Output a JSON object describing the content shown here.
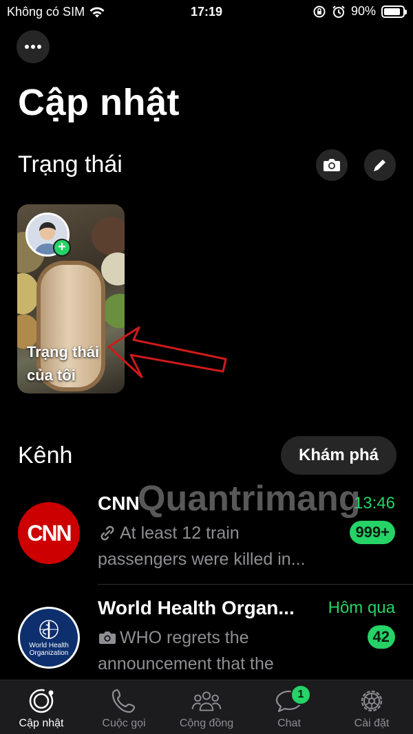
{
  "status_bar": {
    "carrier": "Không có SIM",
    "time": "17:19",
    "battery": "90%",
    "battery_level": 0.9
  },
  "page": {
    "title": "Cập nhật"
  },
  "status_section": {
    "title": "Trạng thái",
    "camera_icon": "camera-icon",
    "pencil_icon": "pencil-icon",
    "my_status_label": "Trạng thái của tôi"
  },
  "channels_section": {
    "title": "Kênh",
    "explore_label": "Khám phá",
    "items": [
      {
        "name": "CNN",
        "time": "13:46",
        "preview_icon": "link-icon",
        "preview": "At least 12 train passengers were killed in...",
        "badge": "999+",
        "avatar_text": "CNN"
      },
      {
        "name": "World Health Organ...",
        "time": "Hôm qua",
        "preview_icon": "camera-icon",
        "preview": "WHO regrets the announcement that the Unite...",
        "badge": "42",
        "avatar_text": "World Health Organization"
      }
    ]
  },
  "watermark": "Quantrimang",
  "tab_bar": {
    "items": [
      {
        "label": "Cập nhật",
        "icon": "updates-icon",
        "active": true
      },
      {
        "label": "Cuộc gọi",
        "icon": "phone-icon"
      },
      {
        "label": "Cộng đồng",
        "icon": "community-icon"
      },
      {
        "label": "Chat",
        "icon": "chat-icon",
        "badge": "1"
      },
      {
        "label": "Cài đặt",
        "icon": "settings-icon"
      }
    ]
  },
  "colors": {
    "accent": "#25d366",
    "background": "#000000",
    "surface": "#262626",
    "cnn_red": "#cc0000",
    "who_blue": "#0d2f6e"
  }
}
